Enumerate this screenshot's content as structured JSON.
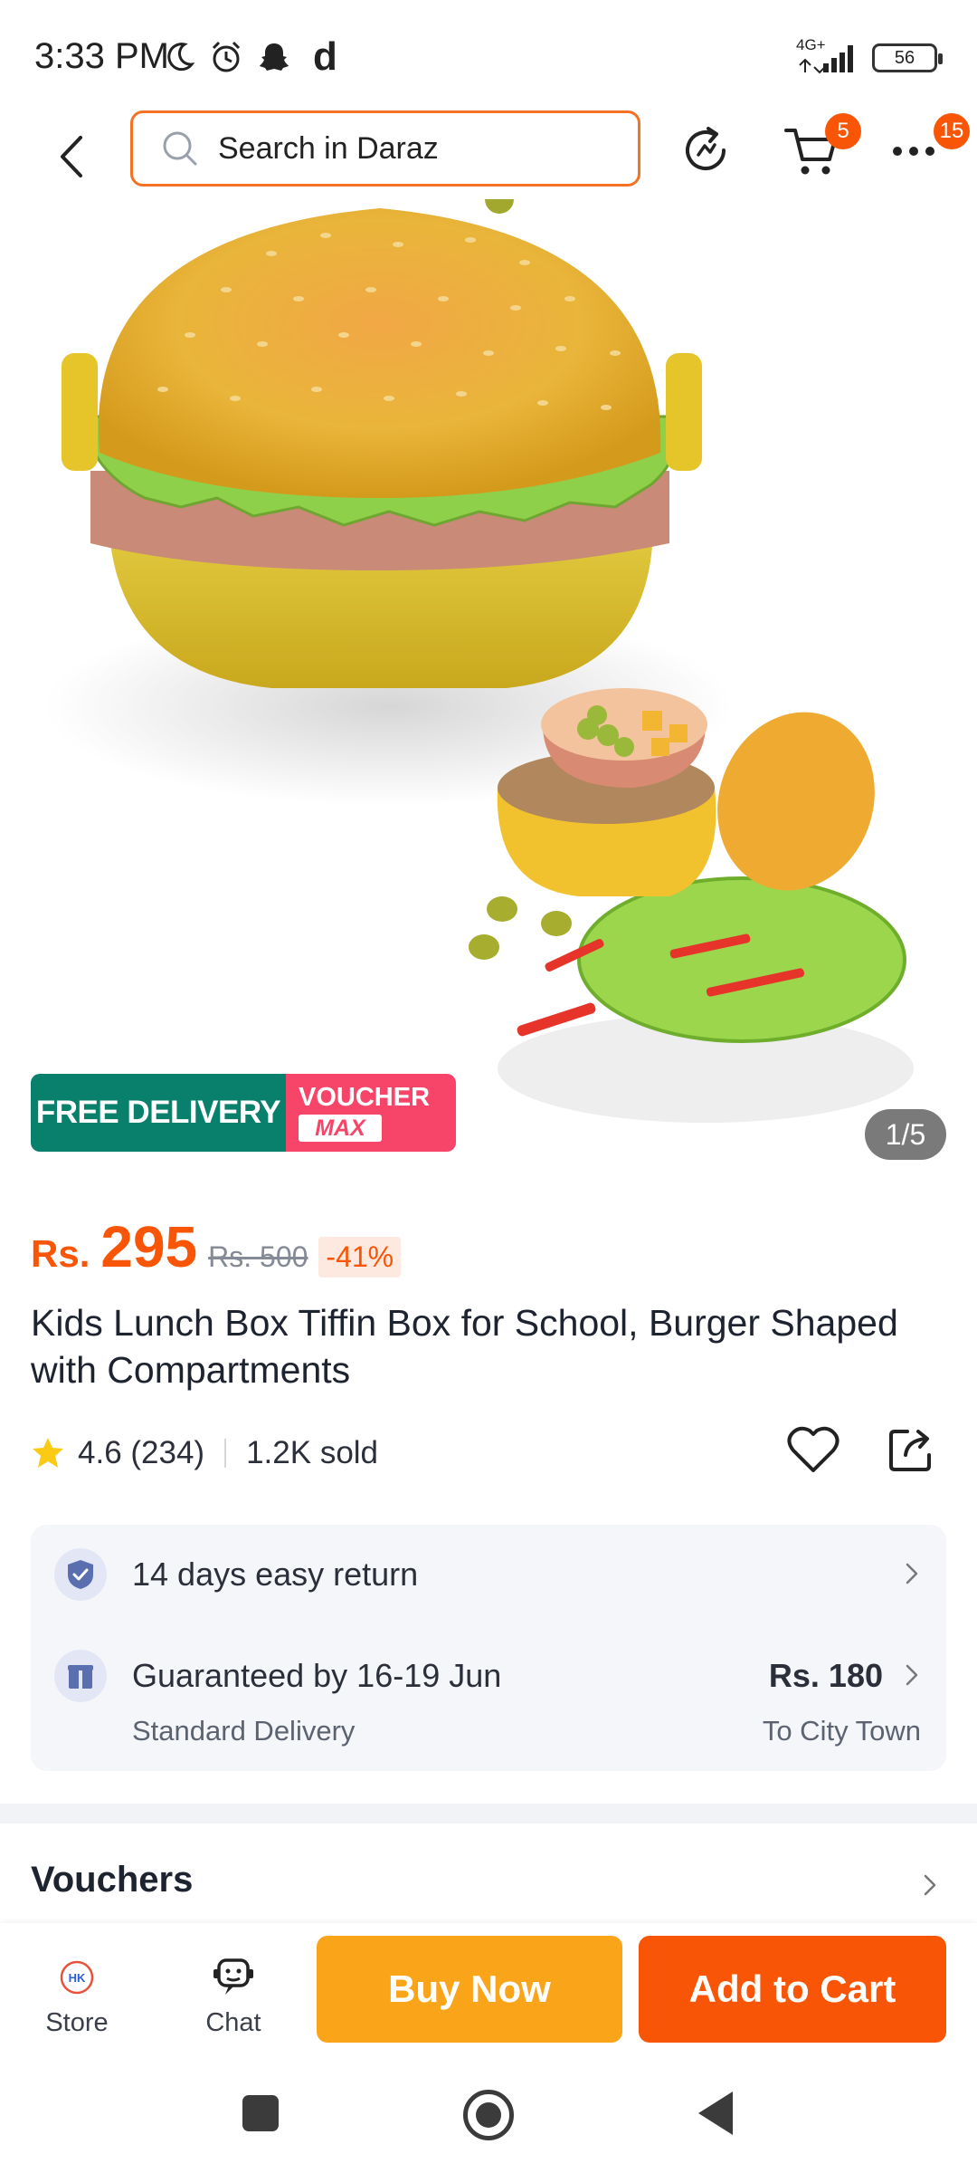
{
  "status_bar": {
    "time": "3:33 PM",
    "app_letter": "d",
    "network": "4G+",
    "battery": "56"
  },
  "header": {
    "search_placeholder": "Search in Daraz",
    "cart_count": "5",
    "more_count": "15"
  },
  "gallery": {
    "counter": "1/5"
  },
  "promo": {
    "free_delivery": "FREE DELIVERY",
    "voucher": "VOUCHER",
    "voucher_max": "MAX"
  },
  "price": {
    "currency": "Rs.",
    "value": "295",
    "original": "Rs. 500",
    "discount": "-41%"
  },
  "product": {
    "title": "Kids Lunch Box Tiffin Box for School, Burger Shaped with Compartments",
    "rating": "4.6 (234)",
    "sold": "1.2K sold"
  },
  "services": {
    "return": "14 days easy return",
    "delivery_main": "Guaranteed by 16-19 Jun",
    "delivery_type": "Standard Delivery",
    "delivery_price": "Rs. 180",
    "delivery_city": "To City Town"
  },
  "vouchers": {
    "title": "Vouchers"
  },
  "bottom_bar": {
    "store": "Store",
    "store_logo_text": "HK",
    "chat": "Chat",
    "buy_now": "Buy Now",
    "add_to_cart": "Add to Cart"
  },
  "colors": {
    "brand_orange": "#f85606",
    "buy_now": "#faa41a",
    "free_delivery_green": "#08806b",
    "voucher_pink": "#f7456a"
  }
}
